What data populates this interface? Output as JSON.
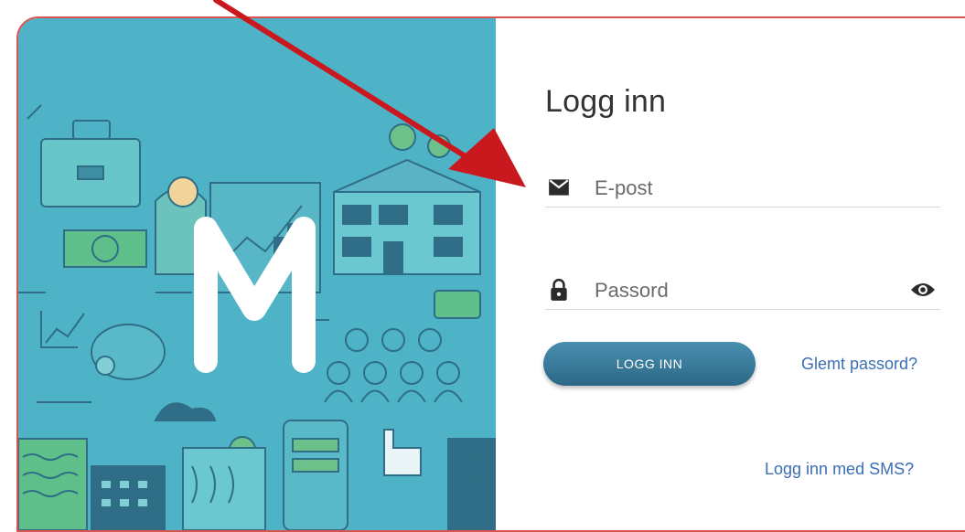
{
  "login": {
    "title": "Logg inn",
    "email_placeholder": "E-post",
    "password_placeholder": "Passord",
    "submit_label": "LOGG INN",
    "forgot_label": "Glemt passord?",
    "sms_label": "Logg inn med SMS?"
  },
  "brand": {
    "logo_letter": "M",
    "illustration_bg": "#4fb3c8",
    "accent": "#2c6786",
    "link_color": "#3b6fb3",
    "frame_color": "#d9534f",
    "arrow_color": "#c9181e"
  },
  "icons": {
    "email": "envelope-icon",
    "password": "lock-icon",
    "toggle": "eye-icon"
  }
}
